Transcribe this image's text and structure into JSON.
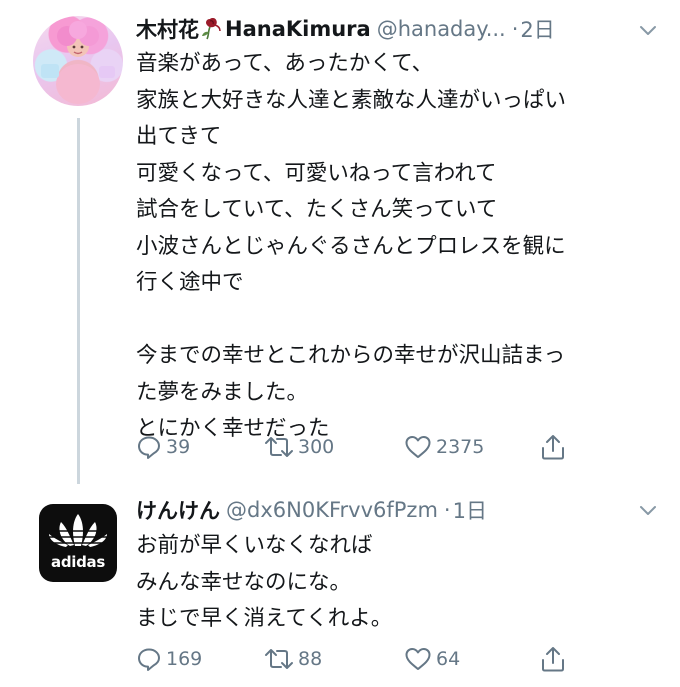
{
  "tweets": [
    {
      "name": "木村花",
      "name_suffix": "HanaKimura",
      "handle": "@hanaday...",
      "separator": "·",
      "time": "2日",
      "avatar_icon": "profile-photo",
      "name_emoji_icon": "wilted-rose-icon",
      "text": "音楽があって、あったかくて、\n家族と大好きな人達と素敵な人達がいっぱい\n出てきて\n可愛くなって、可愛いねって言われて\n試合をしていて、たくさん笑っていて\n小波さんとじゃんぐるさんとプロレスを観に\n行く途中で\n\n今までの幸せとこれからの幸せが沢山詰まっ\nた夢をみました。\nとにかく幸せだった",
      "replies": "39",
      "retweets": "300",
      "likes": "2375"
    },
    {
      "name": "けんけん",
      "handle": "@dx6N0KFrvv6fPzm",
      "separator": "·",
      "time": "1日",
      "avatar_icon": "adidas-logo",
      "avatar_text": "adidas",
      "text": "お前が早くいなくなれば\nみんな幸せなのにな。\nまじで早く消えてくれよ。",
      "replies": "169",
      "retweets": "88",
      "likes": "64"
    }
  ],
  "colors": {
    "text": "#14171a",
    "secondary": "#657786",
    "thread_line": "#ccd6dd",
    "rose": "#9b1b2a"
  }
}
